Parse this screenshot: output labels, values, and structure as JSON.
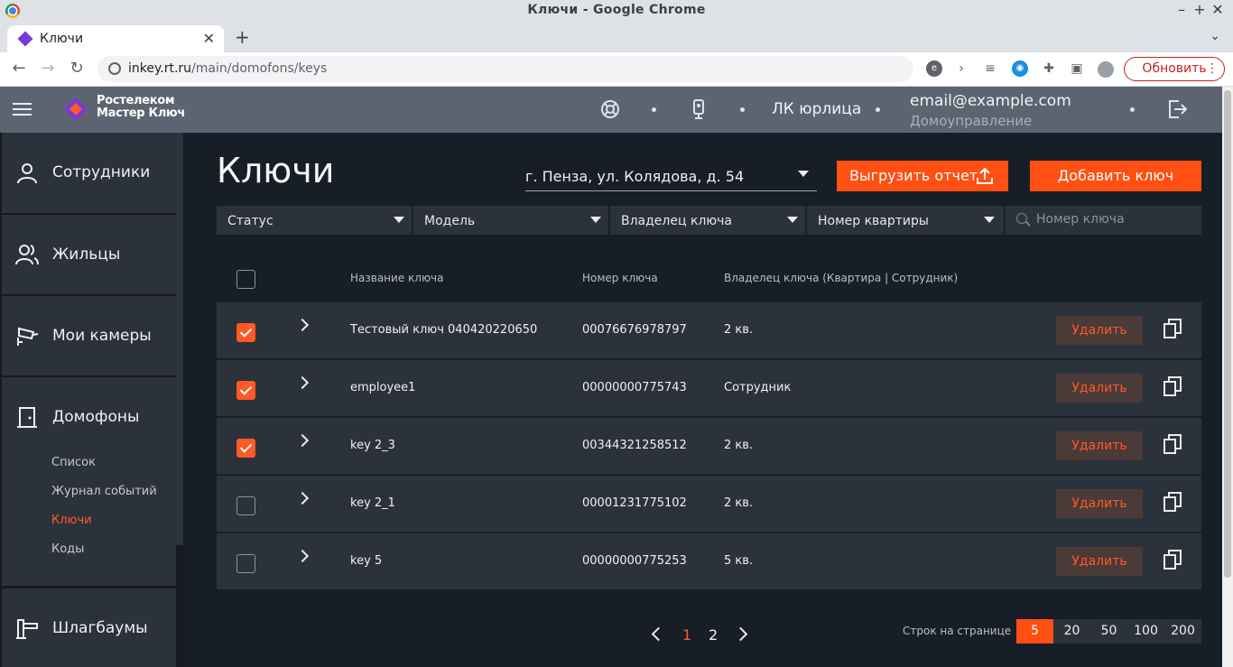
{
  "browser": {
    "window_title": "Ключи - Google Chrome",
    "tab_title": "Ключи",
    "url_host": "inkey.rt.ru",
    "url_path": "/main/domofons/keys",
    "update_button": "Обновить"
  },
  "header": {
    "logo_line1": "Ростелеком",
    "logo_line2": "Мастер Ключ",
    "account_type": "ЛК юрлица",
    "email": "email@example.com",
    "organization": "Домоуправление"
  },
  "sidebar": {
    "items": [
      {
        "label": "Сотрудники",
        "icon": "person-icon"
      },
      {
        "label": "Жильцы",
        "icon": "people-icon"
      },
      {
        "label": "Мои камеры",
        "icon": "camera-icon"
      },
      {
        "label": "Домофоны",
        "icon": "intercom-icon"
      },
      {
        "label": "Шлагбаумы",
        "icon": "barrier-icon"
      }
    ],
    "subitems": [
      "Список",
      "Журнал событий",
      "Ключи",
      "Коды"
    ],
    "active_subitem": "Ключи"
  },
  "page": {
    "title": "Ключи",
    "address": "г. Пенза, ул. Колядова, д. 54",
    "export_button": "Выгрузить отчет",
    "add_button": "Добавить ключ"
  },
  "filters": {
    "status": "Статус",
    "model": "Модель",
    "owner": "Владелец ключа",
    "apartment": "Номер квартиры",
    "search_placeholder": "Номер ключа"
  },
  "table": {
    "columns": [
      "Название ключа",
      "Номер ключа",
      "Владелец ключа (Квартира | Сотрудник)"
    ],
    "delete_label": "Удалить",
    "rows": [
      {
        "name": "Тестовый ключ 040420220650",
        "number": "00076676978797",
        "owner": "2 кв.",
        "checked": true
      },
      {
        "name": "employee1",
        "number": "00000000775743",
        "owner": "Сотрудник",
        "checked": true
      },
      {
        "name": "key 2_3",
        "number": "00344321258512",
        "owner": "2 кв.",
        "checked": true
      },
      {
        "name": "key 2_1",
        "number": "00001231775102",
        "owner": "2 кв.",
        "checked": false
      },
      {
        "name": "key 5",
        "number": "00000000775253",
        "owner": "5 кв.",
        "checked": false
      }
    ]
  },
  "pagination": {
    "pages": [
      "1",
      "2"
    ],
    "current_page": "1",
    "rows_label": "Строк на странице",
    "rows_options": [
      "5",
      "20",
      "50",
      "100",
      "200"
    ],
    "rows_selected": "5"
  },
  "colors": {
    "accent": "#ff4f12",
    "background": "#181e28",
    "panel": "#2c323c",
    "header": "#5d6471"
  }
}
